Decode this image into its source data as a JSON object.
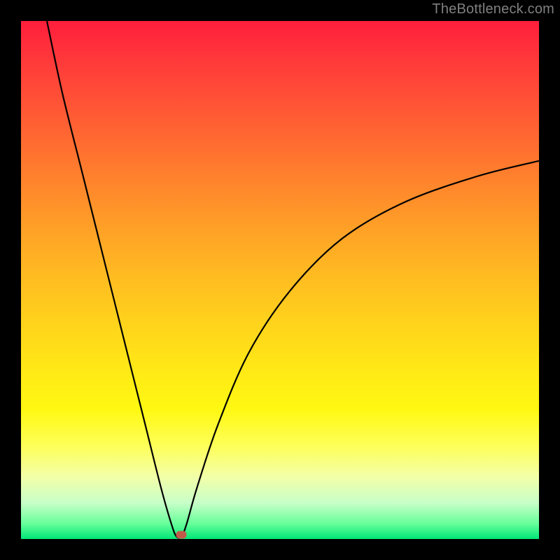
{
  "watermark": "TheBottleneck.com",
  "chart_data": {
    "type": "line",
    "title": "",
    "xlabel": "",
    "ylabel": "",
    "xlim": [
      0,
      100
    ],
    "ylim": [
      0,
      100
    ],
    "grid": false,
    "background_gradient": {
      "top": "#ff1e3c",
      "middle": "#ffe816",
      "bottom": "#00e676"
    },
    "series": [
      {
        "name": "bottleneck-curve",
        "color": "#000000",
        "x": [
          5,
          8,
          12,
          16,
          20,
          24,
          27,
          29,
          30,
          31,
          32,
          34,
          38,
          44,
          52,
          62,
          74,
          88,
          100
        ],
        "y": [
          100,
          86,
          70,
          54,
          38,
          22,
          10,
          3,
          0.5,
          0.5,
          3,
          10,
          22,
          36,
          48,
          58,
          65,
          70,
          73
        ]
      }
    ],
    "marker": {
      "x": 31,
      "y": 0.8,
      "color": "#c25a4a"
    },
    "annotations": []
  }
}
